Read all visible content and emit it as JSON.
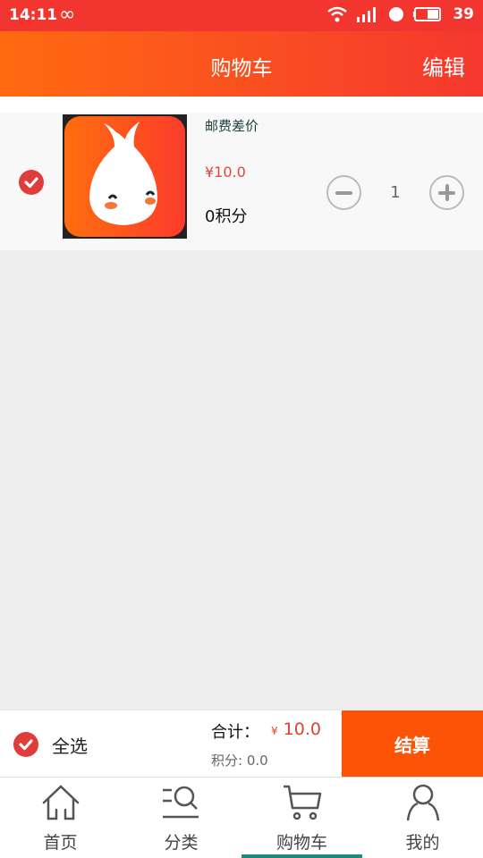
{
  "status_bar": {
    "time": "14:11",
    "infinity": "∞",
    "battery": "39"
  },
  "header": {
    "title": "购物车",
    "edit": "编辑"
  },
  "cart_items": [
    {
      "name": "邮费差价",
      "price": "¥10.0",
      "points": "0积分",
      "quantity": "1",
      "checked": true
    }
  ],
  "footer": {
    "select_all": "全选",
    "total_label": "合计：",
    "currency": "¥",
    "total_value": "10.0",
    "points_label": "积分: 0.0",
    "checkout": "结算"
  },
  "tabs": [
    {
      "label": "首页",
      "icon": "home-icon"
    },
    {
      "label": "分类",
      "icon": "category-search-icon"
    },
    {
      "label": "购物车",
      "icon": "cart-icon",
      "active": true
    },
    {
      "label": "我的",
      "icon": "user-icon"
    }
  ],
  "colors": {
    "accent": "#fd5307",
    "check": "#e03c3c",
    "price": "#e0453f",
    "tab_indicator": "#1e8a7c"
  }
}
